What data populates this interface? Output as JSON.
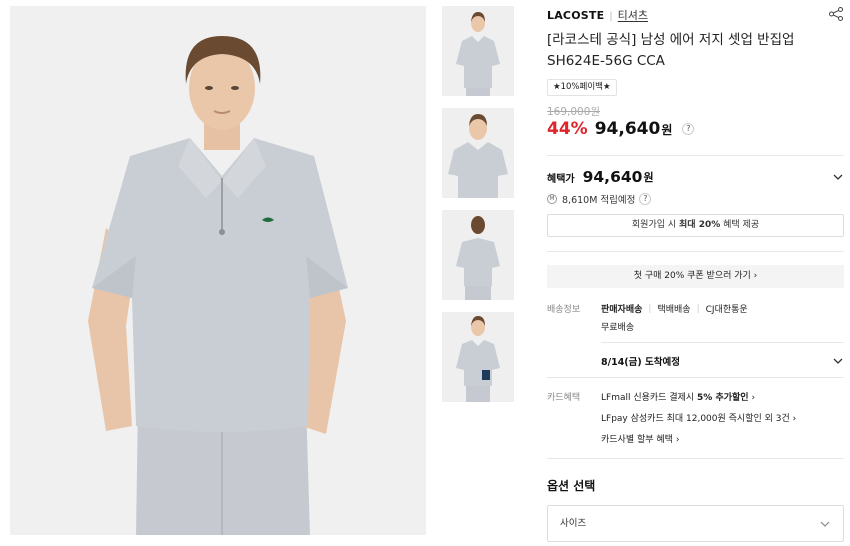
{
  "product": {
    "brand": "LACOSTE",
    "category": "티셔츠",
    "title_line1": "[라코스테 공식] 남성 에어 저지 셋업 반집업",
    "title_line2": "SH624E-56G CCA",
    "badge": "★10%페이백★",
    "original_price": "169,000원",
    "discount": "44%",
    "sale_price": "94,640",
    "currency": "원"
  },
  "benefit": {
    "label": "혜택가",
    "price": "94,640",
    "currency": "원",
    "points_icon": "M",
    "points": "8,610M 적립예정",
    "member_prefix": "회원가입 시 ",
    "member_strong": "최대 20%",
    "member_suffix": " 혜택 제공",
    "coupon": "첫 구매 20% 쿠폰 받으러 가기 ›"
  },
  "shipping": {
    "label": "배송정보",
    "seller": "판매자배송",
    "method": "택배배송",
    "carrier": "CJ대한통운",
    "fee": "무료배송",
    "arrival": "8/14(금) 도착예정"
  },
  "card": {
    "label": "카드혜택",
    "line1_prefix": "LFmall 신용카드 결제시 ",
    "line1_strong": "5% 추가할인",
    "line1_arrow": " ›",
    "line2": "LFpay 삼성카드 최대 12,000원 즉시할인 외 3건 ›",
    "line3": "카드사별 할부 혜택 ›"
  },
  "options": {
    "title": "옵션 선택",
    "size_placeholder": "사이즈"
  },
  "help_glyph": "?",
  "icons": [
    "share-icon",
    "chevron-down-icon",
    "help-icon"
  ],
  "colors": {
    "discount": "#e0242b",
    "shirt": "#c8cdd3",
    "background": "#f1f1f1"
  }
}
